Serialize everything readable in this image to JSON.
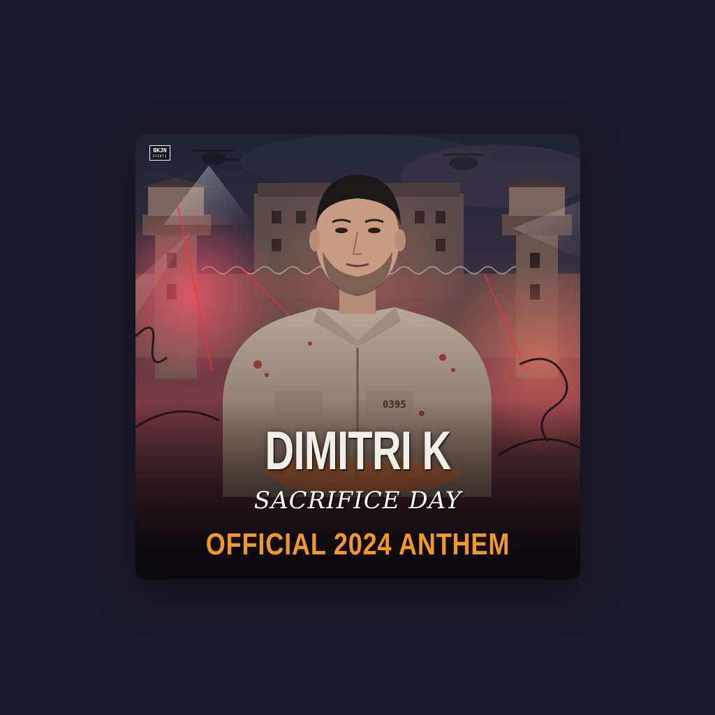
{
  "artwork": {
    "label_logo": "BKJN",
    "label_logo_sub": "EVENTS",
    "artist": "DIMITRI K",
    "title": "SACRIFICE DAY",
    "subtitle": "OFFICIAL 2024 ANTHEM",
    "shirt_number": "0395"
  },
  "colors": {
    "page_background": "#1b1a28",
    "subtitle_accent": "#f29a1f",
    "title_text": "#f2efe9"
  }
}
